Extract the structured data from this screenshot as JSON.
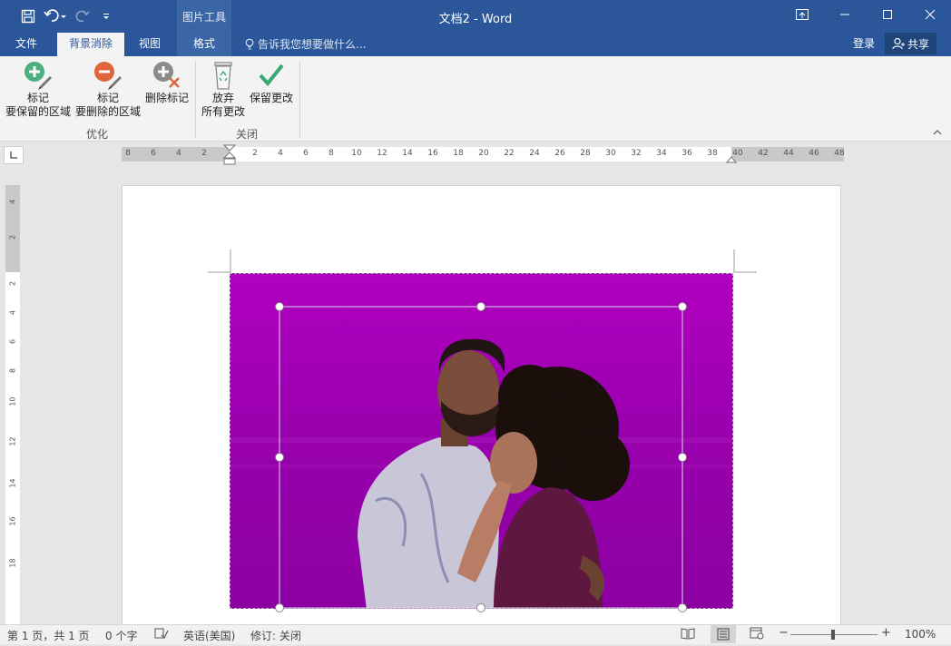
{
  "window": {
    "title": "文档2 - Word"
  },
  "context_tab_group": "图片工具",
  "tabs": [
    {
      "label": "文件"
    },
    {
      "label": "背景消除"
    },
    {
      "label": "视图"
    },
    {
      "label": "格式"
    }
  ],
  "tell_me": "告诉我您想要做什么...",
  "login": "登录",
  "share": "共享",
  "ribbon": {
    "mark_keep": {
      "line1": "标记",
      "line2": "要保留的区域"
    },
    "mark_remove": {
      "line1": "标记",
      "line2": "要删除的区域"
    },
    "delete_mark": "删除标记",
    "discard": {
      "line1": "放弃",
      "line2": "所有更改"
    },
    "keep_changes": "保留更改",
    "group_refine": "优化",
    "group_close": "关闭"
  },
  "hruler_numbers": [
    "8",
    "6",
    "4",
    "2",
    "2",
    "4",
    "6",
    "8",
    "10",
    "12",
    "14",
    "16",
    "18",
    "20",
    "22",
    "24",
    "26",
    "28",
    "30",
    "32",
    "34",
    "36",
    "38",
    "40",
    "42",
    "44",
    "46",
    "48"
  ],
  "vruler_numbers": [
    "4",
    "2",
    "2",
    "4",
    "6",
    "8",
    "10",
    "12",
    "14",
    "16",
    "18"
  ],
  "status": {
    "page": "第 1 页，共 1 页",
    "words": "0 个字",
    "lang": "英语(美国)",
    "track": "修订: 关闭",
    "zoom": "100%"
  },
  "colors": {
    "accent": "#2b579a",
    "background_removal_overlay": "#a000b0"
  }
}
